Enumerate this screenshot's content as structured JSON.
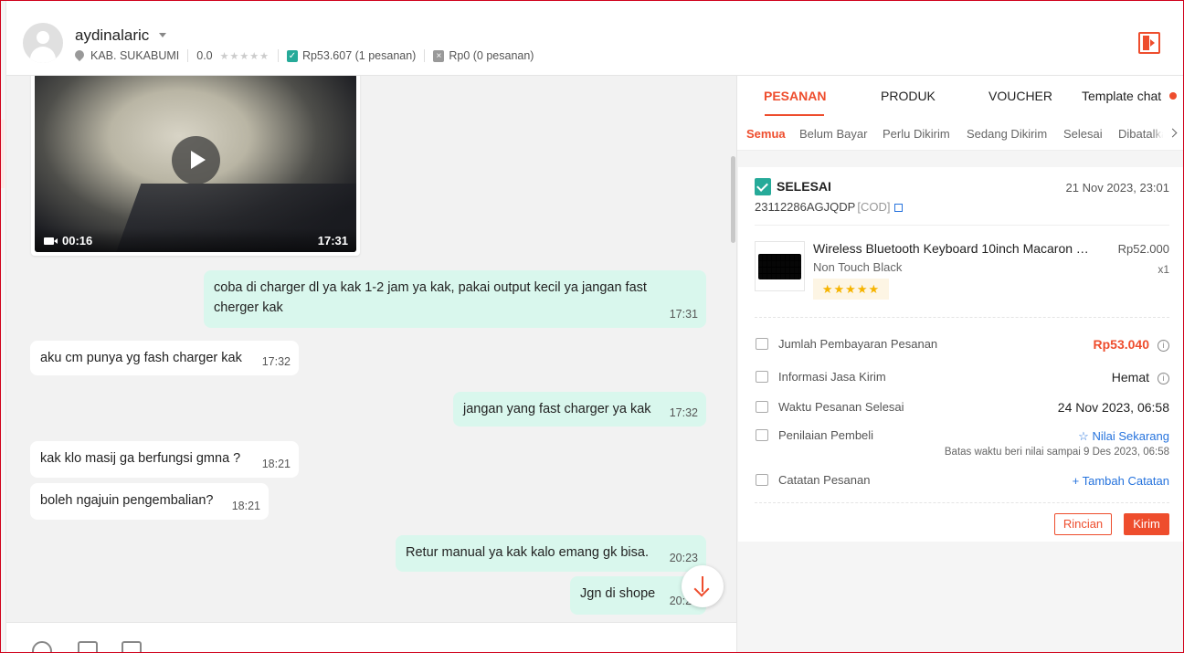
{
  "header": {
    "username": "aydinalaric",
    "location": "KAB. SUKABUMI",
    "rating": "0.0",
    "stars": "★★★★★",
    "completed_orders": "Rp53.607 (1 pesanan)",
    "cancelled_orders": "Rp0 (0 pesanan)"
  },
  "chat": {
    "video": {
      "duration": "00:16",
      "time": "17:31"
    },
    "messages": [
      {
        "direction": "out",
        "text": "coba di charger dl ya kak 1-2 jam ya kak, pakai output kecil ya jangan fast cherger kak",
        "time": "17:31"
      },
      {
        "direction": "in",
        "text": "aku cm punya yg fash charger kak",
        "time": "17:32"
      },
      {
        "direction": "out",
        "text": "jangan yang fast charger ya kak",
        "time": "17:32"
      },
      {
        "direction": "in",
        "text": "kak klo masij ga berfungsi gmna ?",
        "time": "18:21"
      },
      {
        "direction": "in",
        "text": "boleh ngajuin pengembalian?",
        "time": "18:21"
      },
      {
        "direction": "out",
        "text": "Retur manual ya kak kalo emang gk bisa.",
        "time": "20:23"
      },
      {
        "direction": "out",
        "text": "Jgn di shope",
        "time": "20:23"
      }
    ]
  },
  "panel": {
    "tabs": [
      "PESANAN",
      "PRODUK",
      "VOUCHER",
      "Template chat"
    ],
    "active_tab": "PESANAN",
    "subtabs": [
      "Semua",
      "Belum Bayar",
      "Perlu Dikirim",
      "Sedang Dikirim",
      "Selesai",
      "Dibatalkan"
    ],
    "active_subtab": "Semua",
    "order": {
      "status": "SELESAI",
      "date": "21 Nov 2023, 23:01",
      "id": "23112286AGJQDP",
      "payment_tag": "[COD]",
      "product": {
        "name": "Wireless Bluetooth Keyboard 10inch Macaron Tab...",
        "variant": "Non Touch Black",
        "price": "Rp52.000",
        "qty": "x1",
        "rating_stars": "★★★★★"
      },
      "rows": {
        "payment_label": "Jumlah Pembayaran Pesanan",
        "payment_value": "Rp53.040",
        "shipping_label": "Informasi Jasa Kirim",
        "shipping_value": "Hemat",
        "completed_label": "Waktu Pesanan Selesai",
        "completed_value": "24 Nov 2023, 06:58",
        "review_label": "Penilaian Pembeli",
        "review_link": "Nilai Sekarang",
        "review_deadline": "Batas waktu beri nilai sampai 9 Des 2023, 06:58",
        "notes_label": "Catatan Pesanan",
        "notes_link": "Tambah Catatan"
      },
      "buttons": {
        "details": "Rincian",
        "send": "Kirim"
      }
    }
  },
  "colors": {
    "accent": "#ee4d2d",
    "outgoing_bubble": "#d9f7ed",
    "success": "#26aa99",
    "link": "#2673dd"
  }
}
